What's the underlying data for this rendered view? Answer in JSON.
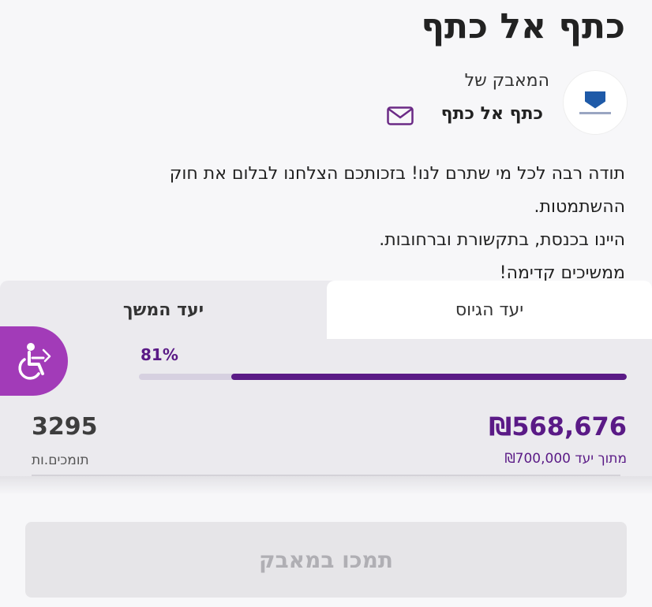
{
  "campaign": {
    "title": "כתף אל כתף",
    "campaign_of_label": "המאבק של",
    "org_name": "כתף אל כתף",
    "description": [
      "תודה רבה לכל מי שתרם לנו! בזכותכם הצלחנו לבלום את חוק ההשתמטות.",
      "היינו בכנסת, בתקשורת וברחובות.",
      "ממשיכים קדימה!"
    ]
  },
  "tabs": {
    "raise_goal": "יעד הגיוס",
    "continue_goal": "יעד המשך"
  },
  "progress": {
    "percent_label": "81%",
    "fraction": 0.81,
    "raised": "₪568,676",
    "goal_line": "מתוך יעד ₪700,000",
    "supporters_count": "3295",
    "supporters_label": "תומכים.ות"
  },
  "actions": {
    "support_button": "תמכו במאבק"
  },
  "icons": {
    "logo": "org-logo-icon",
    "mail": "mail-icon",
    "accessibility": "accessibility-icon"
  },
  "colors": {
    "accent": "#5a1a86",
    "accessibility_bg": "#a23bb8",
    "mail": "#6b2a86"
  }
}
